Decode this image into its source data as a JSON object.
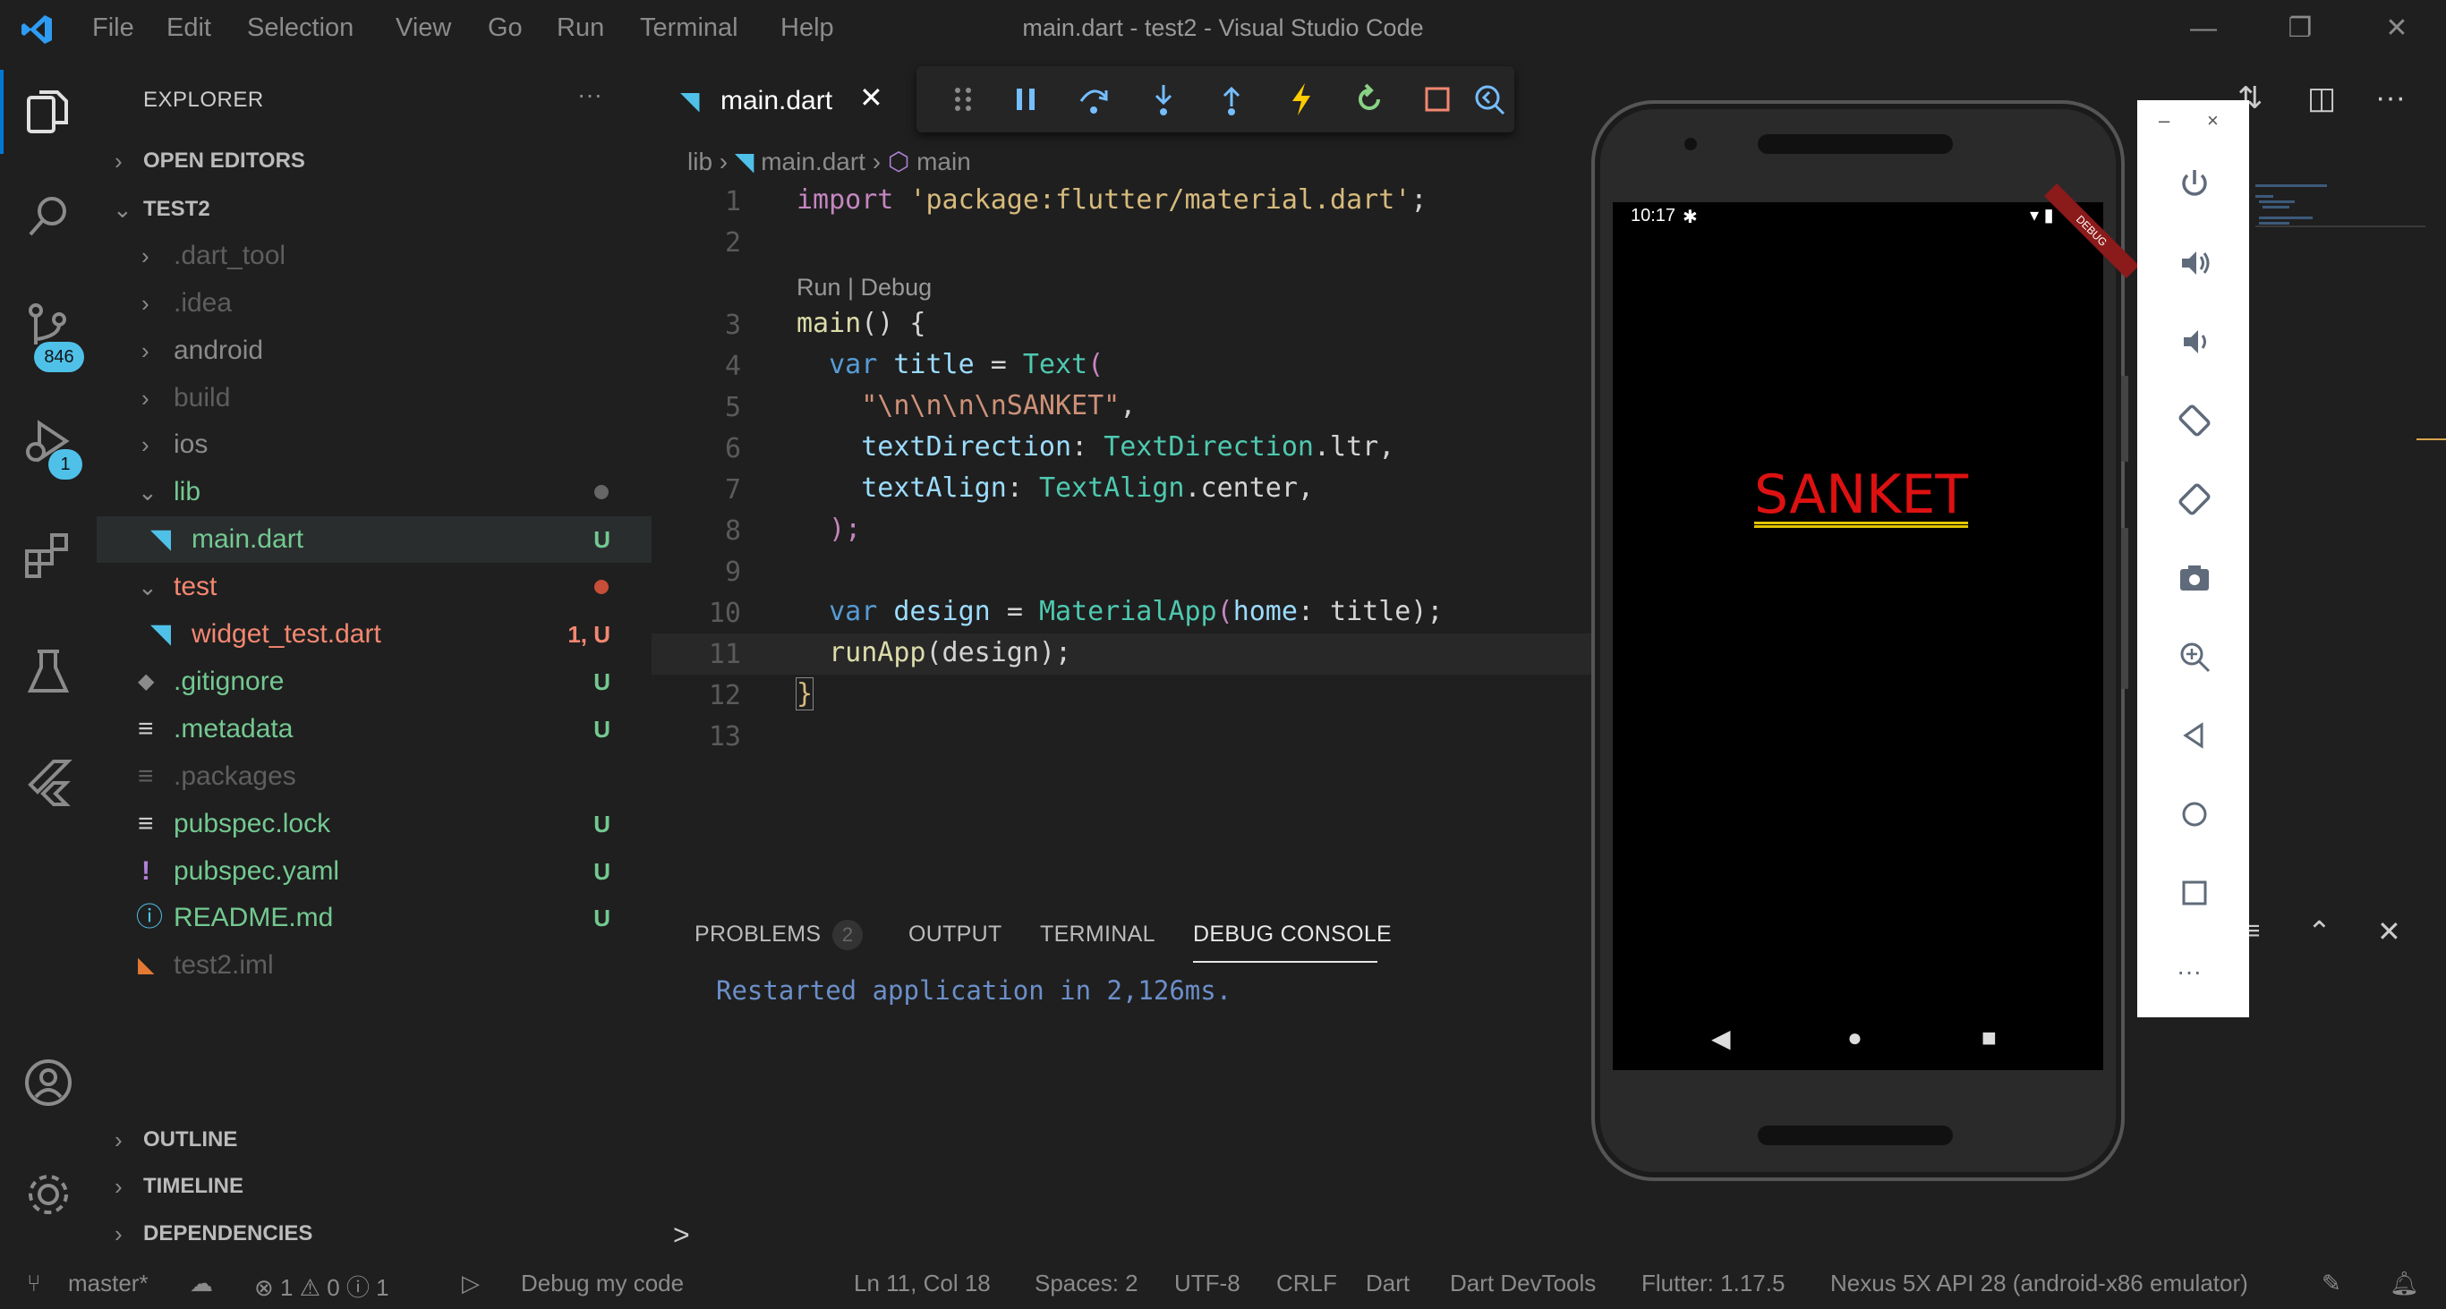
{
  "window": {
    "title": "main.dart - test2 - Visual Studio Code",
    "menu": [
      "File",
      "Edit",
      "Selection",
      "View",
      "Go",
      "Run",
      "Terminal",
      "Help"
    ]
  },
  "activity_bar": {
    "items": [
      {
        "name": "explorer-icon"
      },
      {
        "name": "search-icon"
      },
      {
        "name": "source-control-icon",
        "badge": "846"
      },
      {
        "name": "run-debug-icon",
        "badge": "1"
      },
      {
        "name": "extensions-icon"
      },
      {
        "name": "testing-icon"
      },
      {
        "name": "flutter-icon"
      },
      {
        "name": "accounts-icon"
      },
      {
        "name": "settings-gear-icon"
      }
    ]
  },
  "explorer": {
    "title": "EXPLORER",
    "more": "···",
    "open_editors": "OPEN EDITORS",
    "project": "TEST2",
    "tree": [
      {
        "label": ".dart_tool",
        "status": ""
      },
      {
        "label": ".idea",
        "status": ""
      },
      {
        "label": "android",
        "status": ""
      },
      {
        "label": "build",
        "status": ""
      },
      {
        "label": "ios",
        "status": ""
      },
      {
        "label": "lib",
        "status": ""
      },
      {
        "label": "main.dart",
        "status": "U"
      },
      {
        "label": "test",
        "status": ""
      },
      {
        "label": "widget_test.dart",
        "status": "1, U"
      },
      {
        "label": ".gitignore",
        "status": "U"
      },
      {
        "label": ".metadata",
        "status": "U"
      },
      {
        "label": ".packages",
        "status": ""
      },
      {
        "label": "pubspec.lock",
        "status": "U"
      },
      {
        "label": "pubspec.yaml",
        "status": "U"
      },
      {
        "label": "README.md",
        "status": "U"
      },
      {
        "label": "test2.iml",
        "status": ""
      }
    ],
    "outline": "OUTLINE",
    "timeline": "TIMELINE",
    "dependencies": "DEPENDENCIES"
  },
  "editor": {
    "tab_label": "main.dart",
    "tab_close": "✕",
    "breadcrumb": {
      "folder": "lib",
      "file": "main.dart",
      "symbol": "main"
    },
    "codelens": "Run | Debug",
    "line_numbers": [
      "1",
      "2",
      "3",
      "4",
      "5",
      "6",
      "7",
      "8",
      "9",
      "10",
      "11",
      "12",
      "13"
    ],
    "code": {
      "l1_kw": "import",
      "l1_str": "'package:flutter/material.dart'",
      "l1_end": ";",
      "l3_fn": "main",
      "l3_rest": "() {",
      "l4_kw": "var",
      "l4_name": " title ",
      "l4_eq": "= ",
      "l4_cls": "Text",
      "l4_paren": "(",
      "l5_str": "\"\\n\\n\\n\\nSANKET\"",
      "l5_comma": ",",
      "l6_p": "textDirection",
      "l6_colon": ": ",
      "l6_cls": "TextDirection",
      "l6_rest": ".ltr,",
      "l7_p": "textAlign",
      "l7_colon": ": ",
      "l7_cls": "TextAlign",
      "l7_rest": ".center,",
      "l8": ");",
      "l10_kw": "var",
      "l10_name": " design ",
      "l10_eq": "= ",
      "l10_cls": "MaterialApp",
      "l10_p1": "(",
      "l10_param": "home",
      "l10_rest": ": title);",
      "l11_fn": "runApp",
      "l11_rest": "(design);",
      "l12": "}"
    }
  },
  "panel": {
    "tabs": [
      "PROBLEMS",
      "OUTPUT",
      "TERMINAL",
      "DEBUG CONSOLE"
    ],
    "problems_count": "2",
    "console_output": "Restarted application in 2,126ms.",
    "prompt": ">"
  },
  "status_bar": {
    "branch": "master*",
    "errors": "1",
    "warnings": "0",
    "infos": "1",
    "debug_config": "Debug my code",
    "position": "Ln 11, Col 18",
    "spaces": "Spaces: 2",
    "encoding": "UTF-8",
    "eol": "CRLF",
    "language": "Dart",
    "devtools": "Dart DevTools",
    "flutter": "Flutter: 1.17.5",
    "device": "Nexus 5X API 28 (android-x86 emulator)"
  },
  "emulator": {
    "time": "10:17",
    "app_text": "SANKET",
    "debug_ribbon": "DEBUG",
    "toolbar": {
      "minimize": "–",
      "close": "×",
      "more": "···"
    }
  },
  "colors": {
    "accent": "#0078d4",
    "git_untracked": "#73c991",
    "git_error": "#f48771",
    "app_text": "#dd1111",
    "app_underline": "#e3c400"
  }
}
